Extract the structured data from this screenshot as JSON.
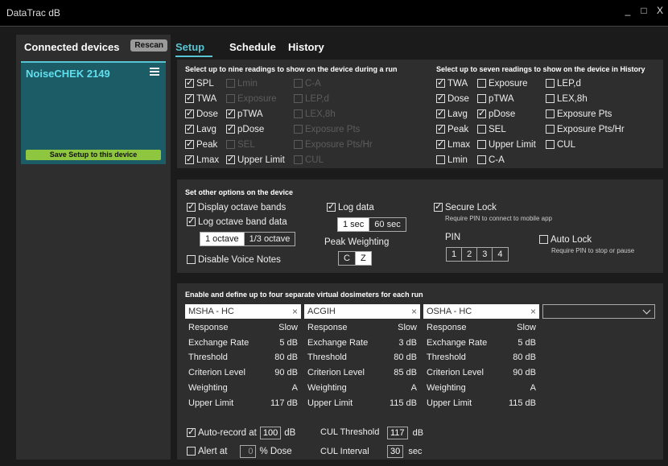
{
  "window": {
    "title": "DataTrac dB",
    "min": "_",
    "max": "□",
    "close": "X"
  },
  "sidebar": {
    "heading": "Connected devices",
    "rescan": "Rescan",
    "device_name": "NoiseCHEK 2149",
    "save_button": "Save Setup to this device"
  },
  "tabs": [
    "Setup",
    "Schedule",
    "History"
  ],
  "run_readings": {
    "title": "Select up to nine readings to show on the device during a run",
    "items": [
      {
        "label": "SPL",
        "checked": true,
        "disabled": false
      },
      {
        "label": "Lmin",
        "checked": false,
        "disabled": true
      },
      {
        "label": "C-A",
        "checked": false,
        "disabled": true
      },
      {
        "label": "TWA",
        "checked": true,
        "disabled": false
      },
      {
        "label": "Exposure",
        "checked": false,
        "disabled": true
      },
      {
        "label": "LEP,d",
        "checked": false,
        "disabled": true
      },
      {
        "label": "Dose",
        "checked": true,
        "disabled": false
      },
      {
        "label": "pTWA",
        "checked": true,
        "disabled": false
      },
      {
        "label": "LEX,8h",
        "checked": false,
        "disabled": true
      },
      {
        "label": "Lavg",
        "checked": true,
        "disabled": false
      },
      {
        "label": "pDose",
        "checked": true,
        "disabled": false
      },
      {
        "label": "Exposure Pts",
        "checked": false,
        "disabled": true
      },
      {
        "label": "Peak",
        "checked": true,
        "disabled": false
      },
      {
        "label": "SEL",
        "checked": false,
        "disabled": true
      },
      {
        "label": "Exposure Pts/Hr",
        "checked": false,
        "disabled": true
      },
      {
        "label": "Lmax",
        "checked": true,
        "disabled": false
      },
      {
        "label": "Upper Limit",
        "checked": true,
        "disabled": false
      },
      {
        "label": "CUL",
        "checked": false,
        "disabled": true
      }
    ]
  },
  "history_readings": {
    "title": "Select up to seven readings to show on the device in History",
    "items": [
      {
        "label": "TWA",
        "checked": true,
        "disabled": false
      },
      {
        "label": "Exposure",
        "checked": false,
        "disabled": false
      },
      {
        "label": "LEP,d",
        "checked": false,
        "disabled": false
      },
      {
        "label": "Dose",
        "checked": true,
        "disabled": false
      },
      {
        "label": "pTWA",
        "checked": false,
        "disabled": false
      },
      {
        "label": "LEX,8h",
        "checked": false,
        "disabled": false
      },
      {
        "label": "Lavg",
        "checked": true,
        "disabled": false
      },
      {
        "label": "pDose",
        "checked": true,
        "disabled": false
      },
      {
        "label": "Exposure Pts",
        "checked": false,
        "disabled": false
      },
      {
        "label": "Peak",
        "checked": true,
        "disabled": false
      },
      {
        "label": "SEL",
        "checked": false,
        "disabled": false
      },
      {
        "label": "Exposure Pts/Hr",
        "checked": false,
        "disabled": false
      },
      {
        "label": "Lmax",
        "checked": true,
        "disabled": false
      },
      {
        "label": "Upper Limit",
        "checked": false,
        "disabled": false
      },
      {
        "label": "CUL",
        "checked": false,
        "disabled": false
      },
      {
        "label": "Lmin",
        "checked": false,
        "disabled": false
      },
      {
        "label": "C-A",
        "checked": false,
        "disabled": false
      }
    ]
  },
  "options": {
    "title": "Set other options on the device",
    "display_octave": "Display octave bands",
    "log_octave": "Log octave band data",
    "octave_1": "1 octave",
    "octave_3": "1/3 octave",
    "disable_voice": "Disable Voice Notes",
    "log_data": "Log data",
    "interval_1": "1 sec",
    "interval_60": "60 sec",
    "peak_weighting": "Peak Weighting",
    "peak_c": "C",
    "peak_z": "Z",
    "secure_lock": "Secure Lock",
    "secure_lock_desc": "Require PIN to connect to mobile app",
    "pin_label": "PIN",
    "pin": [
      "1",
      "2",
      "3",
      "4"
    ],
    "auto_lock": "Auto Lock",
    "auto_lock_desc": "Require PIN to stop or pause"
  },
  "dosimeters": {
    "title": "Enable and define up to four separate virtual dosimeters for each run",
    "row_labels": [
      "Response",
      "Exchange Rate",
      "Threshold",
      "Criterion Level",
      "Weighting",
      "Upper Limit"
    ],
    "items": [
      {
        "name": "MSHA - HC",
        "values": [
          "Slow",
          "5 dB",
          "80 dB",
          "90 dB",
          "A",
          "117 dB"
        ]
      },
      {
        "name": "ACGIH",
        "values": [
          "Slow",
          "3 dB",
          "80 dB",
          "85 dB",
          "A",
          "115 dB"
        ]
      },
      {
        "name": "OSHA - HC",
        "values": [
          "Slow",
          "5 dB",
          "80 dB",
          "90 dB",
          "A",
          "115 dB"
        ]
      }
    ],
    "close_glyph": "×"
  },
  "bottom": {
    "auto_record": "Auto-record at",
    "auto_record_val": "100",
    "auto_record_unit": "dB",
    "alert_at": "Alert at",
    "alert_val": "0",
    "alert_unit": "% Dose",
    "cul_threshold": "CUL Threshold",
    "cul_threshold_val": "117",
    "cul_threshold_unit": "dB",
    "cul_interval": "CUL Interval",
    "cul_interval_val": "30",
    "cul_interval_unit": "sec"
  }
}
